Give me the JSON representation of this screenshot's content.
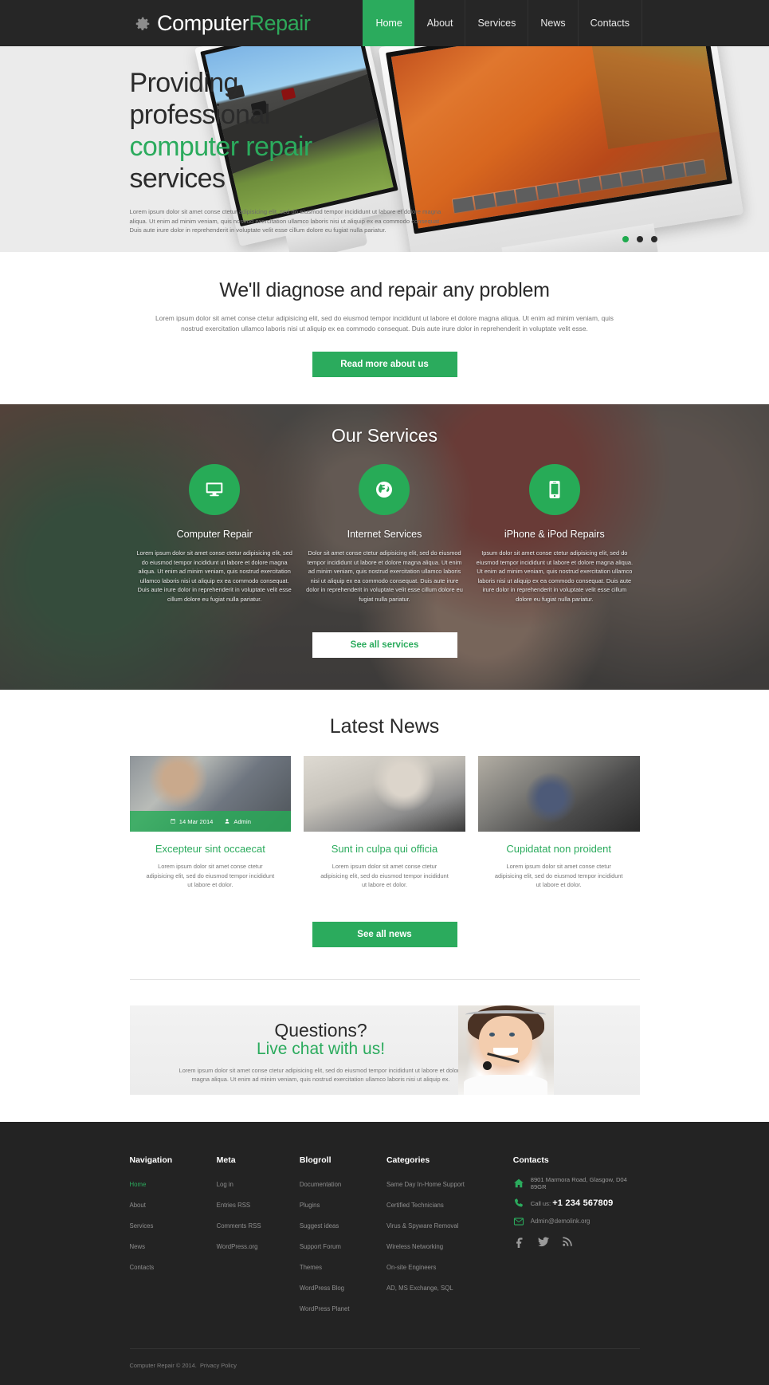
{
  "brand": {
    "word1": "Computer",
    "word2": "Repair",
    "icon": "gear-icon"
  },
  "nav": {
    "items": [
      {
        "label": "Home",
        "active": true
      },
      {
        "label": "About",
        "active": false
      },
      {
        "label": "Services",
        "active": false
      },
      {
        "label": "News",
        "active": false
      },
      {
        "label": "Contacts",
        "active": false
      }
    ]
  },
  "hero": {
    "line1": "Providing",
    "line2": "professional",
    "line3": "computer repair",
    "line4": "services",
    "paragraph": "Lorem ipsum dolor sit amet conse ctetur adipisicing elit, sed do eiusmod tempor incididunt ut labore et dolore magna aliqua. Ut enim ad minim veniam, quis nostrud exercitation ullamco laboris nisi ut aliquip ex ea commodo consequat. Duis aute irure dolor in reprehenderit in voluptate velit esse cillum dolore eu fugiat nulla pariatur.",
    "slider_dots": 3,
    "active_dot": 1
  },
  "diagnose": {
    "title": "We'll diagnose and repair any problem",
    "paragraph": "Lorem ipsum dolor sit amet conse ctetur adipisicing elit, sed do eiusmod tempor incididunt ut labore et dolore magna aliqua. Ut enim ad minim veniam, quis nostrud exercitation ullamco laboris nisi ut aliquip ex ea commodo consequat. Duis aute irure dolor in reprehenderit in voluptate velit esse.",
    "button": "Read more about us"
  },
  "services": {
    "title": "Our Services",
    "button": "See all services",
    "items": [
      {
        "icon": "monitor-icon",
        "title": "Computer Repair",
        "text": "Lorem ipsum dolor sit amet conse ctetur adipisicing elit, sed do eiusmod tempor incididunt ut labore et dolore magna aliqua. Ut enim ad minim veniam, quis nostrud exercitation ullamco laboris nisi ut aliquip ex ea commodo consequat. Duis aute irure dolor in reprehenderit in voluptate velit esse cillum dolore eu fugiat nulla pariatur."
      },
      {
        "icon": "globe-icon",
        "title": "Internet Services",
        "text": "Dolor sit amet conse ctetur adipisicing elit, sed do eiusmod tempor incididunt ut labore et dolore magna aliqua. Ut enim ad minim veniam, quis nostrud exercitation ullamco laboris nisi ut aliquip ex ea commodo consequat. Duis aute irure dolor in reprehenderit in voluptate velit esse cillum dolore eu fugiat nulla pariatur."
      },
      {
        "icon": "smartphone-icon",
        "title": "iPhone & iPod Repairs",
        "text": "Ipsum dolor sit amet conse ctetur adipisicing elit, sed do eiusmod tempor incididunt ut labore et dolore magna aliqua. Ut enim ad minim veniam, quis nostrud exercitation ullamco laboris nisi ut aliquip ex ea commodo consequat. Duis aute irure dolor in reprehenderit in voluptate velit esse cillum dolore eu fugiat nulla pariatur."
      }
    ]
  },
  "news": {
    "title": "Latest News",
    "button": "See all news",
    "items": [
      {
        "date": "14 Mar 2014",
        "author": "Admin",
        "title": "Excepteur sint occaecat",
        "text": "Lorem ipsum dolor sit amet conse ctetur adipisicing elit, sed do eiusmod tempor incididunt ut labore et dolor.",
        "has_meta": true
      },
      {
        "date": "",
        "author": "",
        "title": "Sunt in culpa qui officia",
        "text": "Lorem ipsum dolor sit amet conse ctetur adipisicing elit, sed do eiusmod tempor incididunt ut labore et dolor.",
        "has_meta": false
      },
      {
        "date": "",
        "author": "",
        "title": "Cupidatat non proident",
        "text": "Lorem ipsum dolor sit amet conse ctetur adipisicing elit, sed do eiusmod tempor incididunt ut labore et dolor.",
        "has_meta": false
      }
    ]
  },
  "questions": {
    "title": "Questions?",
    "subtitle": "Live chat with us!",
    "paragraph": "Lorem ipsum dolor sit amet conse ctetur adipisicing elit, sed do eiusmod tempor incididunt ut labore et dolore magna aliqua. Ut enim ad minim veniam, quis nostrud exercitation ullamco laboris nisi ut aliquip ex."
  },
  "footer": {
    "navigation": {
      "heading": "Navigation",
      "links": [
        "Home",
        "About",
        "Services",
        "News",
        "Contacts"
      ]
    },
    "meta": {
      "heading": "Meta",
      "links": [
        "Log in",
        "Entries RSS",
        "Comments RSS",
        "WordPress.org"
      ]
    },
    "blogroll": {
      "heading": "Blogroll",
      "links": [
        "Documentation",
        "Plugins",
        "Suggest ideas",
        "Support Forum",
        "Themes",
        "WordPress Blog",
        "WordPress Planet"
      ]
    },
    "categories": {
      "heading": "Categories",
      "links": [
        "Same Day In-Home Support",
        "Certified Technicians",
        "Virus & Spyware Removal",
        "Wireless Networking",
        "On-site Engineers",
        "AD, MS Exchange, SQL"
      ]
    },
    "contacts": {
      "heading": "Contacts",
      "address": "8901 Marmora Road,  Glasgow,  D04 89GR",
      "call_label": "Call us:",
      "phone": "+1 234 567809",
      "email": "Admin@demolink.org",
      "socials": [
        "facebook-icon",
        "twitter-icon",
        "rss-icon"
      ]
    },
    "copyright": "Computer Repair  © 2014.",
    "privacy": "Privacy Policy"
  },
  "colors": {
    "accent": "#2bab5d",
    "dark": "#262626",
    "footer": "#232323"
  }
}
